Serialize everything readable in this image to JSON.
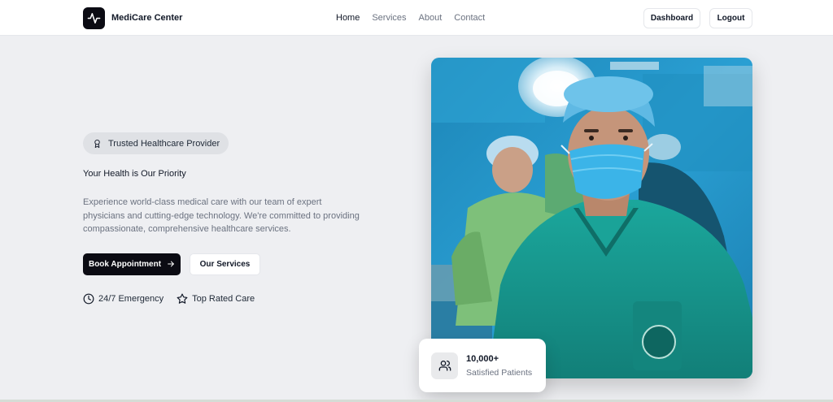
{
  "brand": {
    "name": "MediCare Center",
    "logo_icon": "activity-pulse-icon"
  },
  "nav": {
    "links": [
      "Home",
      "Services",
      "About",
      "Contact"
    ],
    "active": "Home",
    "dashboard_label": "Dashboard",
    "logout_label": "Logout"
  },
  "hero": {
    "badge": "Trusted Healthcare Provider",
    "tagline": "Your Health is Our Priority",
    "description": "Experience world-class medical care with our team of expert physicians and cutting-edge technology. We're committed to providing compassionate, comprehensive healthcare services.",
    "primary_cta": "Book Appointment",
    "secondary_cta": "Our Services",
    "features": [
      {
        "label": "24/7 Emergency",
        "icon": "clock-icon"
      },
      {
        "label": "Top Rated Care",
        "icon": "star-icon"
      }
    ]
  },
  "stat": {
    "value": "10,000+",
    "label": "Satisfied Patients",
    "icon": "users-icon"
  },
  "colors": {
    "primary": "#0b0b13",
    "background": "#eeeff2",
    "scrub_teal": "#1a9e96",
    "mask_blue": "#3bb4e8"
  }
}
